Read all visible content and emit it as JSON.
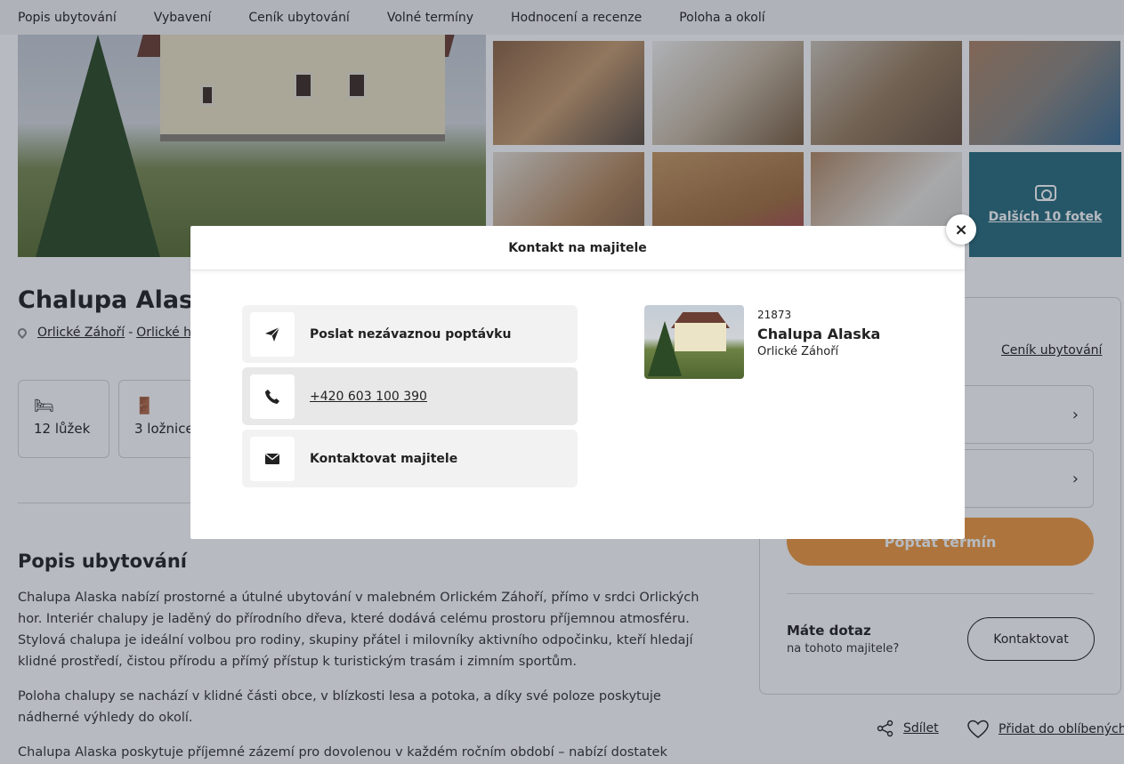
{
  "nav": {
    "items": [
      "Popis ubytování",
      "Vybavení",
      "Ceník ubytování",
      "Volné termíny",
      "Hodnocení a recenze",
      "Poloha a okolí"
    ]
  },
  "gallery": {
    "more_label": "Dalších 10 fotek"
  },
  "property": {
    "title": "Chalupa Alaska",
    "location_1": "Orlické Záhoří",
    "location_sep": "-",
    "location_2": "Orlické hory",
    "features": [
      {
        "icon": "bed-icon",
        "label": "12 lůžek"
      },
      {
        "icon": "door-icon",
        "label": "3 ložnice"
      }
    ]
  },
  "description": {
    "heading": "Popis ubytování",
    "p1": "Chalupa Alaska nabízí prostorné a útulné ubytování v malebném Orlickém Záhoří, přímo v srdci Orlických hor. Interiér chalupy je laděný do přírodního dřeva, které dodává celému prostoru příjemnou atmosféru. Stylová chalupa je ideální volbou pro rodiny, skupiny přátel i milovníky aktivního odpočinku, kteří hledají klidné prostředí, čistou přírodu a přímý přístup k turistickým trasám i zimním sportům.",
    "p2": "Poloha chalupy se nachází v klidné části obce, v blízkosti lesa a potoka, a díky své poloze poskytuje nádherné výhledy do okolí.",
    "p3": "Chalupa Alaska poskytuje příjemné zázemí pro dovolenou v každém ročním období – nabízí dostatek"
  },
  "panel": {
    "price_link": "Ceník ubytování",
    "cta": "Poptat termín",
    "question_title": "Máte dotaz",
    "question_sub": "na tohoto majitele?",
    "contact_button": "Kontaktovat"
  },
  "share": {
    "share_label": "Sdílet",
    "favorite_label": "Přidat do oblíbených"
  },
  "modal": {
    "title": "Kontakt na majitele",
    "close_glyph": "×",
    "options": {
      "inquiry": "Poslat nezávaznou poptávku",
      "phone": "+420 603 100 390",
      "message": "Kontaktovat majitele"
    },
    "card": {
      "id": "21873",
      "name": "Chalupa Alaska",
      "location": "Orlické Záhoří"
    }
  }
}
